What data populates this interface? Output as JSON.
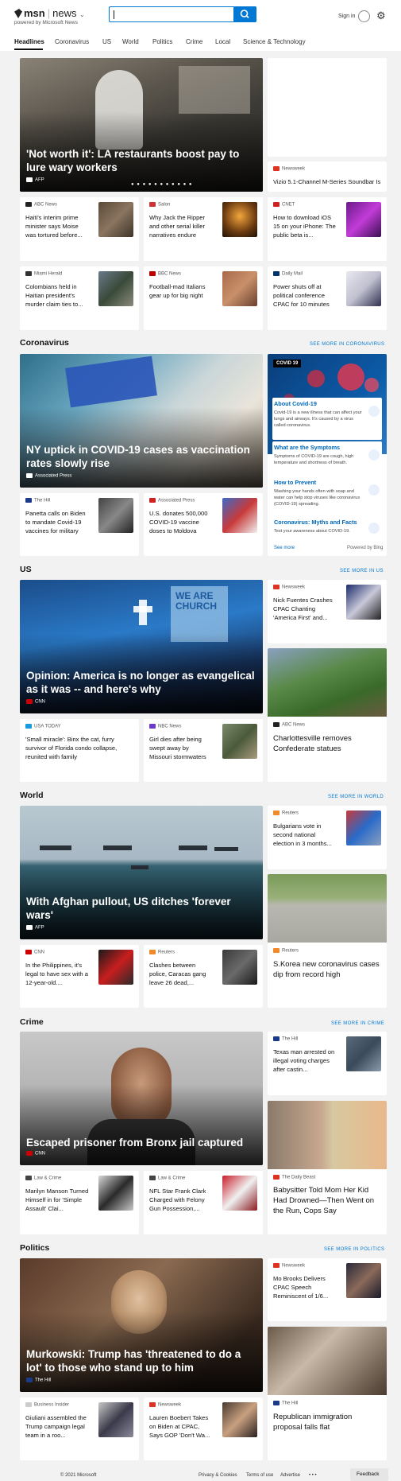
{
  "header": {
    "brand": "msn",
    "section": "news",
    "powered_by": "powered by Microsoft News",
    "signin": "Sign in"
  },
  "nav": [
    "Headlines",
    "Coronavirus",
    "US",
    "World",
    "Politics",
    "Crime",
    "Local",
    "Science & Technology"
  ],
  "headlines": {
    "hero": {
      "title": "'Not worth it': LA restaurants boost pay to lure wary workers",
      "source": "AFP"
    },
    "side": {
      "source": "Newsweek",
      "title": "Vizio 5.1-Channel M-Series Soundbar Is ..."
    },
    "cards": [
      {
        "source": "ABC News",
        "title": "Haiti's interim prime minister says Moise was tortured before..."
      },
      {
        "source": "Salon",
        "title": "Why Jack the Ripper and other serial killer narratives endure"
      },
      {
        "source": "CNET",
        "title": "How to download iOS 15 on your iPhone: The public beta is..."
      },
      {
        "source": "Miami Herald",
        "title": "Colombians held in Haitian president's murder claim ties to..."
      },
      {
        "source": "BBC News",
        "title": "Football-mad Italians gear up for big night"
      },
      {
        "source": "Daily Mail",
        "title": "Power shuts off at political conference CPAC for 10 minutes"
      }
    ]
  },
  "coronavirus": {
    "heading": "Coronavirus",
    "see_more": "SEE MORE IN CORONAVIRUS",
    "hero": {
      "title": "NY uptick in COVID-19 cases as vaccination rates slowly rise",
      "source": "Associated Press"
    },
    "cards": [
      {
        "source": "The Hill",
        "title": "Panetta calls on Biden to mandate Covid-19 vaccines for military"
      },
      {
        "source": "Associated Press",
        "title": "U.S. donates 500,000 COVID-19 vaccine doses to Moldova"
      }
    ],
    "panel": {
      "tag": "COVID 19",
      "items": [
        {
          "title": "About Covid-19",
          "desc": "Covid-19 is a new illness that can affect your lungs and airways. It's caused by a virus called coronavirus."
        },
        {
          "title": "What are the Symptoms",
          "desc": "Symptoms of COVID-19 are cough, high temperature and shortness of breath."
        },
        {
          "title": "How to Prevent",
          "desc": "Washing your hands often with soap and water can help stop viruses like coronavirus (COVID-19) spreading."
        },
        {
          "title": "Coronavirus: Myths and Facts",
          "desc": "Test your awareness about COVID-19."
        }
      ],
      "see_more": "See more",
      "powered": "Powered by Bing"
    }
  },
  "us": {
    "heading": "US",
    "see_more": "SEE MORE IN US",
    "hero": {
      "title": "Opinion: America is no longer as evangelical as it was -- and here's why",
      "source": "CNN"
    },
    "side1": {
      "source": "Newsweek",
      "title": "Nick Fuentes Crashes CPAC Chanting 'America First' and..."
    },
    "side2": {
      "source": "ABC News",
      "title": "Charlottesville removes Confederate statues"
    },
    "cards": [
      {
        "source": "USA TODAY",
        "title": "'Small miracle': Binx the cat, furry survivor of Florida condo collapse, reunited with family"
      },
      {
        "source": "NBC News",
        "title": "Girl dies after being swept away by Missouri stormwaters"
      }
    ],
    "hero_sign": "WE ARE CHURCH"
  },
  "world": {
    "heading": "World",
    "see_more": "SEE MORE IN WORLD",
    "hero": {
      "title": "With Afghan pullout, US ditches 'forever wars'",
      "source": "AFP"
    },
    "side1": {
      "source": "Reuters",
      "title": "Bulgarians vote in second national election in 3 months..."
    },
    "side2": {
      "source": "Reuters",
      "title": "S.Korea new coronavirus cases dip from record high"
    },
    "cards": [
      {
        "source": "CNN",
        "title": "In the Philippines, it's legal to have sex with a 12-year-old...."
      },
      {
        "source": "Reuters",
        "title": "Clashes between police, Caracas gang leave 26 dead,..."
      }
    ]
  },
  "crime": {
    "heading": "Crime",
    "see_more": "SEE MORE IN CRIME",
    "hero": {
      "title": "Escaped prisoner from Bronx jail captured",
      "source": "CNN"
    },
    "side1": {
      "source": "The Hill",
      "title": "Texas man arrested on illegal voting charges after castin..."
    },
    "side2": {
      "source": "The Daily Beast",
      "title": "Babysitter Told Mom Her Kid Had Drowned—Then Went on the Run, Cops Say"
    },
    "cards": [
      {
        "source": "Law & Crime",
        "title": "Marilyn Manson Turned Himself in for 'Simple Assault' Clai..."
      },
      {
        "source": "Law & Crime",
        "title": "NFL Star Frank Clark Charged with Felony Gun Possession,..."
      }
    ]
  },
  "politics": {
    "heading": "Politics",
    "see_more": "SEE MORE IN POLITICS",
    "hero": {
      "title": "Murkowski: Trump has 'threatened to do a lot' to those who stand up to him",
      "source": "The Hill"
    },
    "side1": {
      "source": "Newsweek",
      "title": "Mo Brooks Delivers CPAC Speech Reminiscent of 1/6..."
    },
    "side2": {
      "source": "The Hill",
      "title": "Republican immigration proposal falls flat"
    },
    "cards": [
      {
        "source": "Business Insider",
        "title": "Giuliani assembled the Trump campaign legal team in a roo..."
      },
      {
        "source": "Newsweek",
        "title": "Lauren Boebert Takes on Biden at CPAC, Says GOP 'Don't Wa..."
      }
    ]
  },
  "footer": {
    "copyright": "© 2021 Microsoft",
    "privacy": "Privacy & Cookies",
    "terms": "Terms of use",
    "advertise": "Advertise",
    "more": "• • •",
    "feedback": "Feedback"
  }
}
